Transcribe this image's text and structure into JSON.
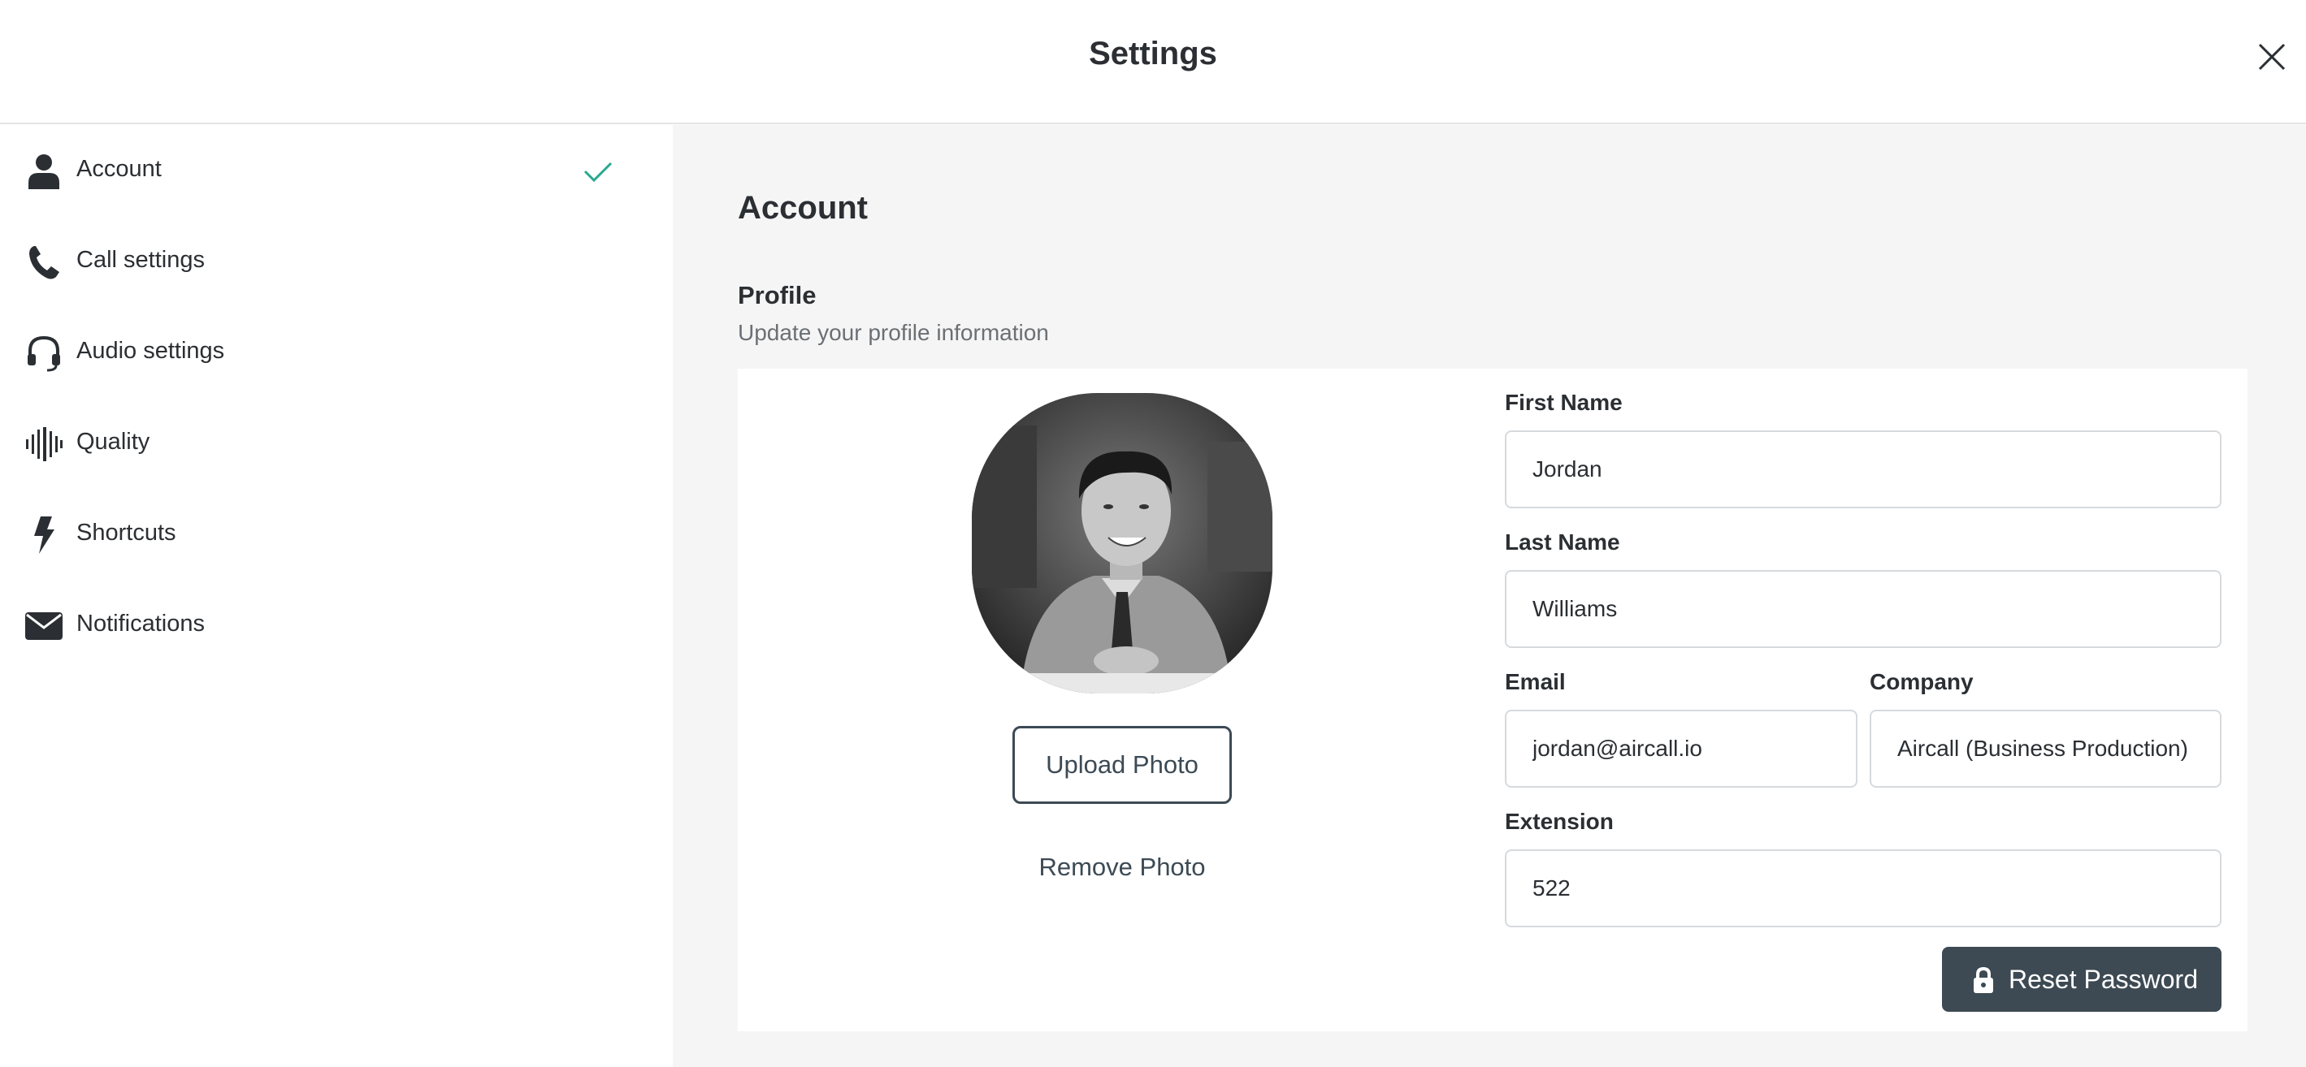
{
  "header": {
    "title": "Settings"
  },
  "sidebar": {
    "items": [
      {
        "label": "Account",
        "icon": "person-icon",
        "active": true
      },
      {
        "label": "Call settings",
        "icon": "phone-icon"
      },
      {
        "label": "Audio settings",
        "icon": "headset-icon"
      },
      {
        "label": "Quality",
        "icon": "waveform-icon"
      },
      {
        "label": "Shortcuts",
        "icon": "lightning-icon"
      },
      {
        "label": "Notifications",
        "icon": "envelope-icon"
      }
    ]
  },
  "main": {
    "title": "Account",
    "profile": {
      "title": "Profile",
      "subtitle": "Update your profile information",
      "upload_label": "Upload Photo",
      "remove_label": "Remove Photo",
      "fields": {
        "first_name": {
          "label": "First Name",
          "value": "Jordan"
        },
        "last_name": {
          "label": "Last Name",
          "value": "Williams"
        },
        "email": {
          "label": "Email",
          "value": "jordan@aircall.io"
        },
        "company": {
          "label": "Company",
          "value": "Aircall (Business Production)"
        },
        "extension": {
          "label": "Extension",
          "value": "522"
        }
      },
      "reset_label": "Reset Password"
    }
  },
  "colors": {
    "accent_check": "#2aa88f",
    "button_dark": "#3d4a53",
    "panel_bg": "#f5f5f5"
  }
}
